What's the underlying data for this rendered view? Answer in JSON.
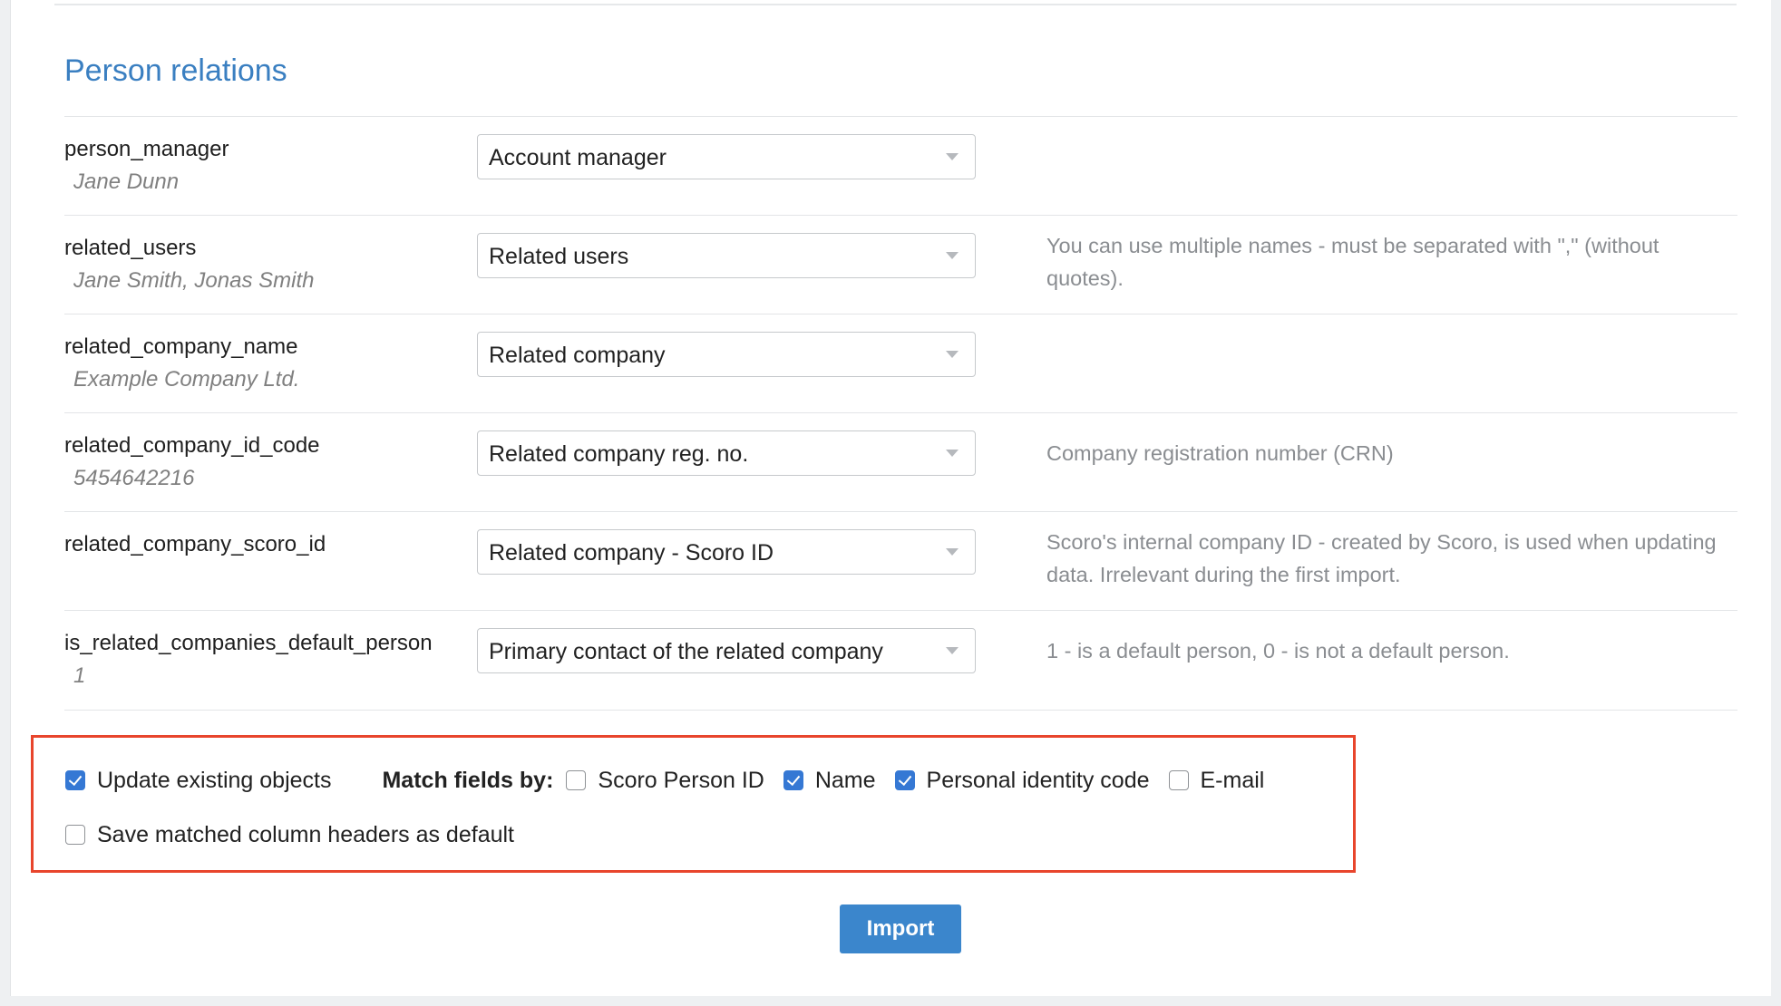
{
  "section": {
    "title": "Person relations"
  },
  "rows": [
    {
      "field": "person_manager",
      "example": "Jane Dunn",
      "selected": "Account manager",
      "hint": ""
    },
    {
      "field": "related_users",
      "example": "Jane Smith, Jonas Smith",
      "selected": "Related users",
      "hint": "You can use multiple names - must be separated with \",\" (without quotes)."
    },
    {
      "field": "related_company_name",
      "example": "Example Company Ltd.",
      "selected": "Related company",
      "hint": ""
    },
    {
      "field": "related_company_id_code",
      "example": "5454642216",
      "selected": "Related company reg. no.",
      "hint": "Company registration number (CRN)"
    },
    {
      "field": "related_company_scoro_id",
      "example": "",
      "selected": "Related company - Scoro ID",
      "hint": "Scoro's internal company ID - created by Scoro, is used when updating data. Irrelevant during the first import."
    },
    {
      "field": "is_related_companies_default_person",
      "example": "1",
      "selected": "Primary contact of the related company",
      "hint": "1 - is a default person, 0 - is not a default person."
    }
  ],
  "options": {
    "update_existing": {
      "label": "Update existing objects",
      "checked": true
    },
    "match_fields_label": "Match fields by:",
    "match_fields": [
      {
        "label": "Scoro Person ID",
        "checked": false
      },
      {
        "label": "Name",
        "checked": true
      },
      {
        "label": "Personal identity code",
        "checked": true
      },
      {
        "label": "E-mail",
        "checked": false
      }
    ],
    "save_headers": {
      "label": "Save matched column headers as default",
      "checked": false
    }
  },
  "actions": {
    "import_label": "Import"
  },
  "colors": {
    "accent": "#3a7fc1",
    "checkbox_checked": "#3578d4",
    "highlight_border": "#e8452c",
    "button": "#3b86cc"
  }
}
